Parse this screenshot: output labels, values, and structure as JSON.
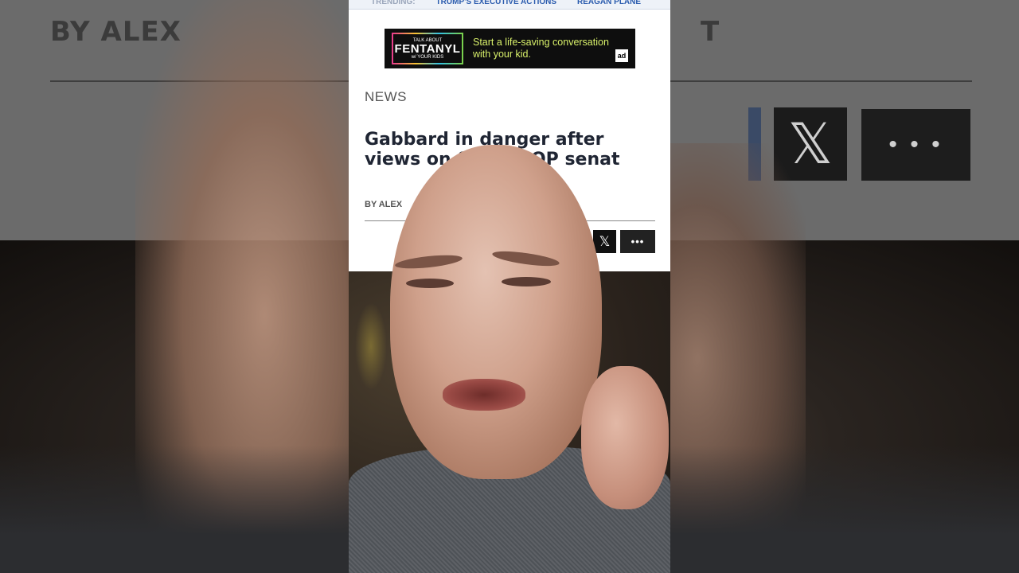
{
  "background": {
    "byline_left": "BY ALEX",
    "byline_right": "T",
    "x_icon": "x-logo-icon",
    "more_label": "• • •"
  },
  "trending": {
    "label": "TRENDING:",
    "items": [
      "TRUMP'S EXECUTIVE ACTIONS",
      "REAGAN PLANE"
    ]
  },
  "ad": {
    "logo_small_top": "TALK ABOUT",
    "logo_word": "FENTANYL",
    "logo_small_bottom": "w/ YOUR KIDS",
    "text": "Start a life-saving conversation with your kid.",
    "badge": "ad"
  },
  "article": {
    "section": "NEWS",
    "headline": "Gabbard in danger after views on Snow           GOP senat",
    "byline_left": "BY ALEX",
    "byline_right": "T"
  },
  "share": {
    "x_icon": "x-logo-icon",
    "x_glyph": "𝕏",
    "more_label": "•••"
  },
  "colors": {
    "link_blue": "#2b5cae",
    "headline": "#1f2533",
    "ad_text": "#d9f16a",
    "facebook": "#3b5998"
  }
}
